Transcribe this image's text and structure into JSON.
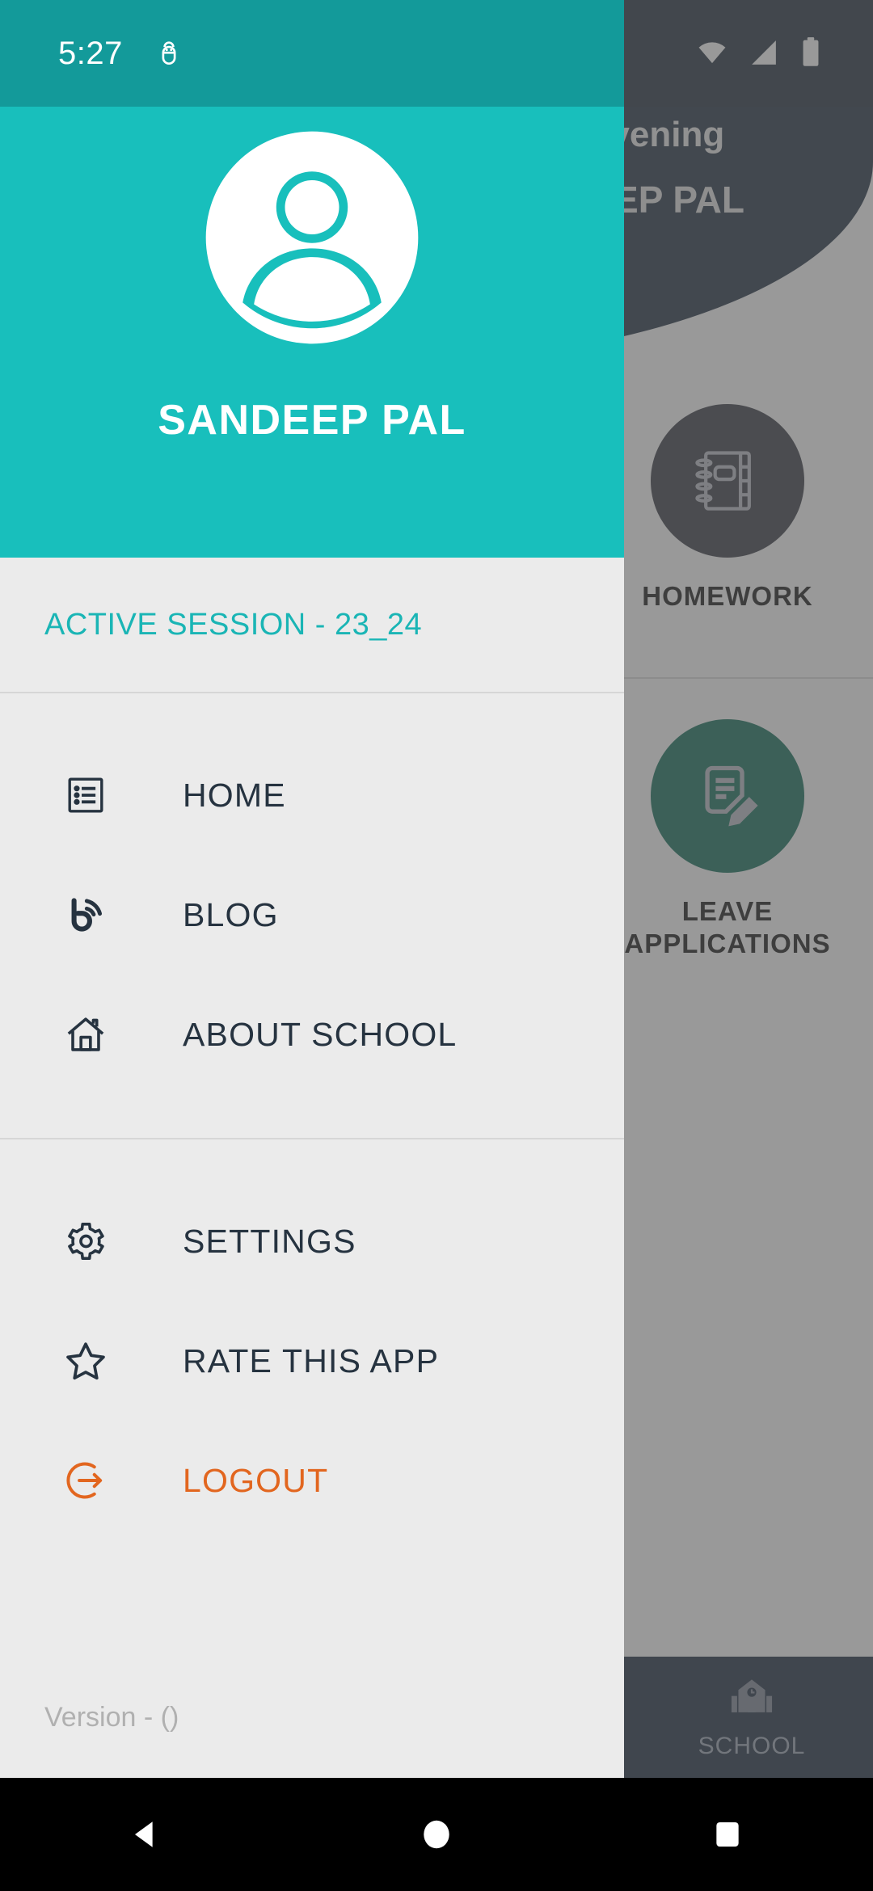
{
  "status_bar": {
    "time": "5:27",
    "icons": [
      "bug-icon",
      "wifi-icon",
      "cellular-signal-icon",
      "battery-icon"
    ]
  },
  "drawer": {
    "avatar_icon": "user-avatar-icon",
    "user_name": "SANDEEP PAL",
    "session_label": "ACTIVE SESSION - 23_24",
    "primary_items": [
      {
        "label": "HOME",
        "icon": "list-feed-icon"
      },
      {
        "label": "BLOG",
        "icon": "blogger-rss-icon"
      },
      {
        "label": "ABOUT SCHOOL",
        "icon": "house-icon"
      }
    ],
    "secondary_items": [
      {
        "label": "SETTINGS",
        "icon": "gear-icon"
      },
      {
        "label": "RATE THIS APP",
        "icon": "star-outline-icon"
      },
      {
        "label": "LOGOUT",
        "icon": "logout-arrow-icon"
      }
    ],
    "version_text": "Version -  ()",
    "colors": {
      "header_teal": "#18bfbc",
      "status_teal": "#139a9a",
      "body_gray": "#ebebeb",
      "session_teal": "#1ab5b5",
      "logout_orange": "#e2661f",
      "text_dark": "#263340"
    }
  },
  "background_app": {
    "greeting": "Good Evening",
    "user_name": "SANDEEP PAL",
    "header_color": "#1b2a3d",
    "tiles": [
      {
        "label": "HOMEWORK",
        "icon": "spiral-notebook-icon",
        "circle_color": "#33353f"
      },
      {
        "label": "LEAVE APPLICATIONS",
        "icon": "document-pencil-icon",
        "circle_color": "#0d6b55"
      }
    ],
    "bottom_nav": [
      {
        "label": "SCHOOL",
        "icon": "school-building-icon"
      }
    ]
  },
  "android_nav": {
    "back": "back-triangle-icon",
    "home": "home-circle-icon",
    "recents": "recents-square-icon"
  }
}
